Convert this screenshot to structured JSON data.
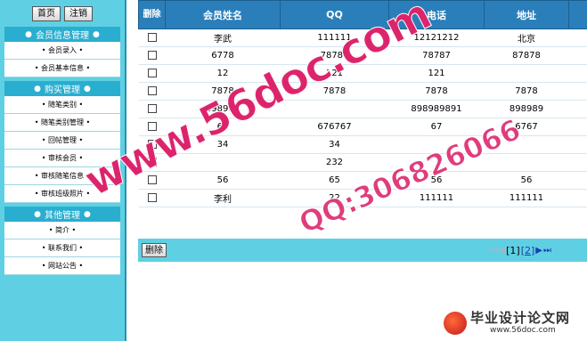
{
  "sidebar": {
    "top_buttons": {
      "home": "首页",
      "logout": "注销"
    },
    "groups": [
      {
        "title": "会员信息管理",
        "items": [
          "• 会员录入 •",
          "• 会员基本信息 •"
        ]
      },
      {
        "title": "购买管理",
        "items": [
          "• 随笔类别 •",
          "• 随笔类别管理 •",
          "• 回帖管理 •",
          "• 审核会员 •",
          "• 审核随笔信息 •",
          "• 审核班级照片 •"
        ]
      },
      {
        "title": "其他管理",
        "items": [
          "• 简介 •",
          "• 联系我们 •",
          "• 网站公告 •"
        ]
      }
    ]
  },
  "grid": {
    "headers": {
      "delete": "删除",
      "name": "会员姓名",
      "qq": "QQ",
      "phone": "电话",
      "address": "地址"
    },
    "rows": [
      {
        "name": "李武",
        "qq": "111111",
        "phone": "12121212",
        "address": "北京"
      },
      {
        "name": "6778",
        "qq": "78787",
        "phone": "78787",
        "address": "87878"
      },
      {
        "name": "12",
        "qq": "121",
        "phone": "121",
        "address": ""
      },
      {
        "name": "7878",
        "qq": "7878",
        "phone": "7878",
        "address": "7878"
      },
      {
        "name": "898989",
        "qq": "",
        "phone": "898989891",
        "address": "898989"
      },
      {
        "name": "67",
        "qq": "676767",
        "phone": "67",
        "address": "6767"
      },
      {
        "name": "34",
        "qq": "34",
        "phone": "",
        "address": ""
      },
      {
        "name": "",
        "qq": "232",
        "phone": "",
        "address": ""
      },
      {
        "name": "56",
        "qq": "65",
        "phone": "56",
        "address": "56"
      },
      {
        "name": "李利",
        "qq": "22",
        "phone": "111111",
        "address": "111111"
      }
    ]
  },
  "footer": {
    "delete_button": "删除",
    "pager": {
      "first": "⏮",
      "prev": "◀",
      "current": "[1]",
      "next_page": "[2]",
      "next": "▶",
      "last": "⏭"
    }
  },
  "watermark": {
    "site": "www.56doc.com",
    "qq": "QQ:306826066",
    "logo_text": "毕业设计论文网",
    "logo_url": "www.56doc.com"
  },
  "colors": {
    "sidebar": "#5fd0e3",
    "header": "#2a7fbb",
    "watermark": "#e62878"
  }
}
